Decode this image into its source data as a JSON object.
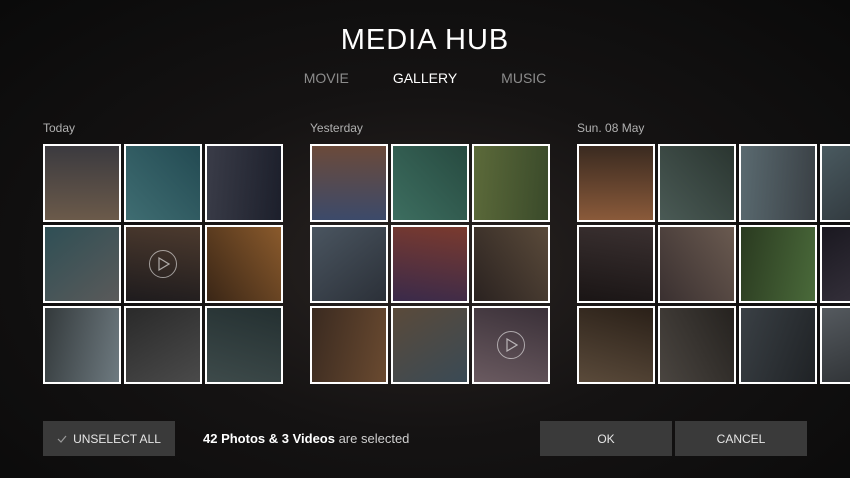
{
  "header": {
    "title": "MEDIA HUB"
  },
  "tabs": [
    {
      "label": "MOVIE",
      "active": false
    },
    {
      "label": "GALLERY",
      "active": true
    },
    {
      "label": "MUSIC",
      "active": false
    }
  ],
  "groups": [
    {
      "label": "Today",
      "video_indices": [
        4
      ]
    },
    {
      "label": "Yesterday",
      "video_indices": [
        8
      ]
    },
    {
      "label": "Sun. 08 May",
      "video_indices": []
    }
  ],
  "footer": {
    "unselect_label": "UNSELECT ALL",
    "selection_count": "42 Photos & 3 Videos",
    "selection_suffix": " are selected",
    "ok_label": "OK",
    "cancel_label": "CANCEL"
  },
  "colors": {
    "accent_border": "#ffffff",
    "button_bg": "#3a3a3a"
  }
}
